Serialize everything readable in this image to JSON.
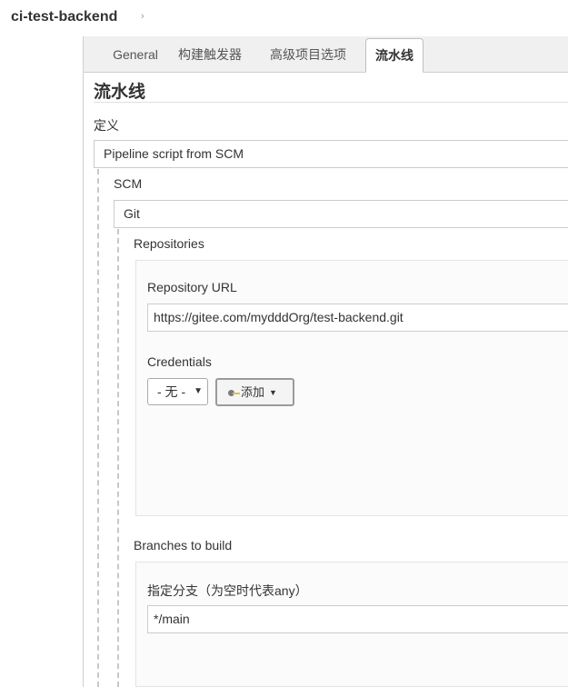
{
  "breadcrumb": {
    "job_name": "ci-test-backend",
    "arrow": "›"
  },
  "tabs": [
    {
      "label": "General"
    },
    {
      "label": "构建触发器"
    },
    {
      "label": "高级项目选项"
    },
    {
      "label": "流水线"
    }
  ],
  "pipeline": {
    "section_title": "流水线",
    "definition_label": "定义",
    "definition_value": "Pipeline script from SCM",
    "scm_label": "SCM",
    "scm_value": "Git",
    "repositories_label": "Repositories",
    "repo_url_label": "Repository URL",
    "repo_url_value": "https://gitee.com/mydddOrg/test-backend.git",
    "credentials_label": "Credentials",
    "credentials_selected": "- 无 -",
    "add_button_label": "添加",
    "branches_label": "Branches to build",
    "branch_specifier_label": "指定分支（为空时代表any）",
    "branch_specifier_value": "*/main"
  },
  "icons": {
    "key": "key-icon",
    "dropdown": "chevron-down-icon",
    "caret": "caret-down-icon"
  }
}
